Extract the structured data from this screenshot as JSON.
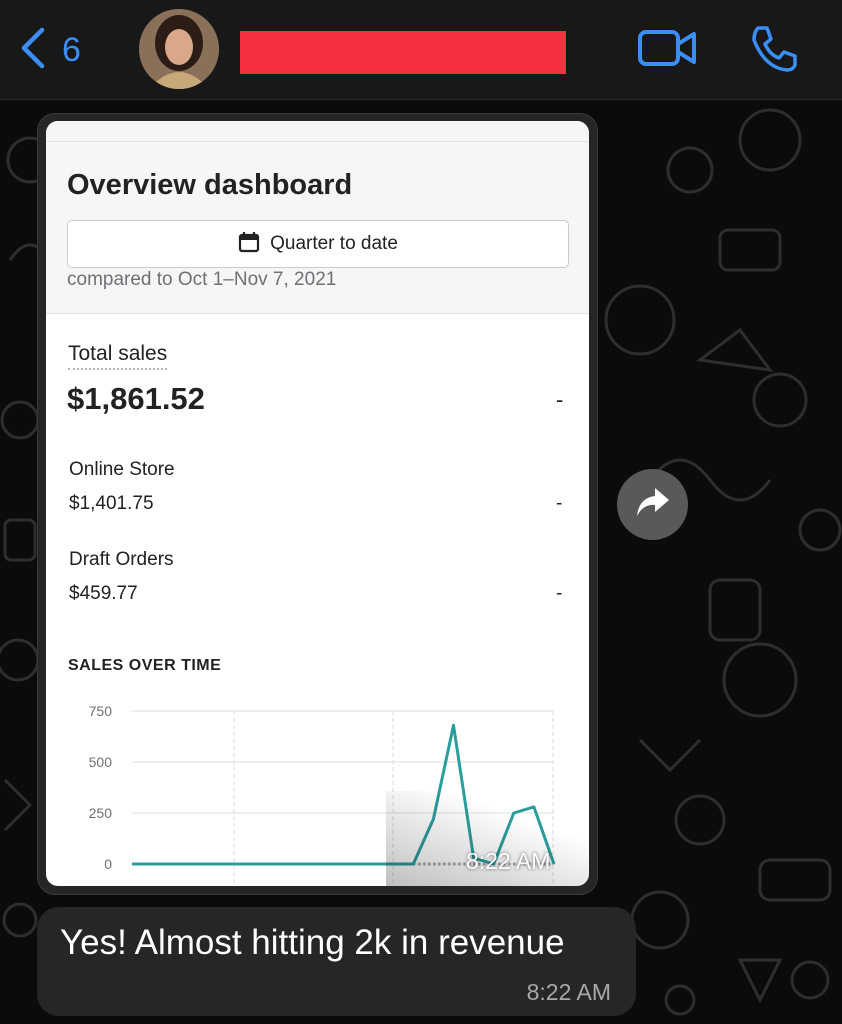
{
  "header": {
    "back_count": "6",
    "accent": "#3a8ef6",
    "redaction_color": "#f5313f"
  },
  "screenshot": {
    "title": "Overview dashboard",
    "date_range": "Quarter to date",
    "compared": "compared to Oct 1–Nov 7, 2021",
    "total_sales_label": "Total sales",
    "total_sales_value": "$1,861.52",
    "total_sales_change": "-",
    "rows": [
      {
        "label": "Online Store",
        "value": "$1,401.75",
        "change": "-"
      },
      {
        "label": "Draft Orders",
        "value": "$459.77",
        "change": "-"
      }
    ],
    "chart_title": "SALES OVER TIME",
    "image_time": "8:22 AM"
  },
  "chart_data": {
    "type": "line",
    "title": "SALES OVER TIME",
    "xlabel": "",
    "ylabel": "",
    "ylim": [
      0,
      750
    ],
    "yticks": [
      "750",
      "500",
      "250",
      "0"
    ],
    "grid": true,
    "line_color": "#2a9d9d",
    "x": [
      0,
      1,
      2,
      3,
      4,
      5,
      6,
      7,
      8,
      9,
      10,
      11,
      12,
      13,
      14,
      15,
      16,
      17,
      18,
      19,
      20,
      21
    ],
    "series": [
      {
        "values": [
          0,
          0,
          0,
          0,
          0,
          0,
          0,
          0,
          0,
          0,
          0,
          0,
          0,
          0,
          0,
          220,
          680,
          30,
          0,
          250,
          280,
          0
        ]
      }
    ]
  },
  "message": {
    "text": "Yes! Almost hitting 2k in revenue",
    "time": "8:22 AM"
  }
}
